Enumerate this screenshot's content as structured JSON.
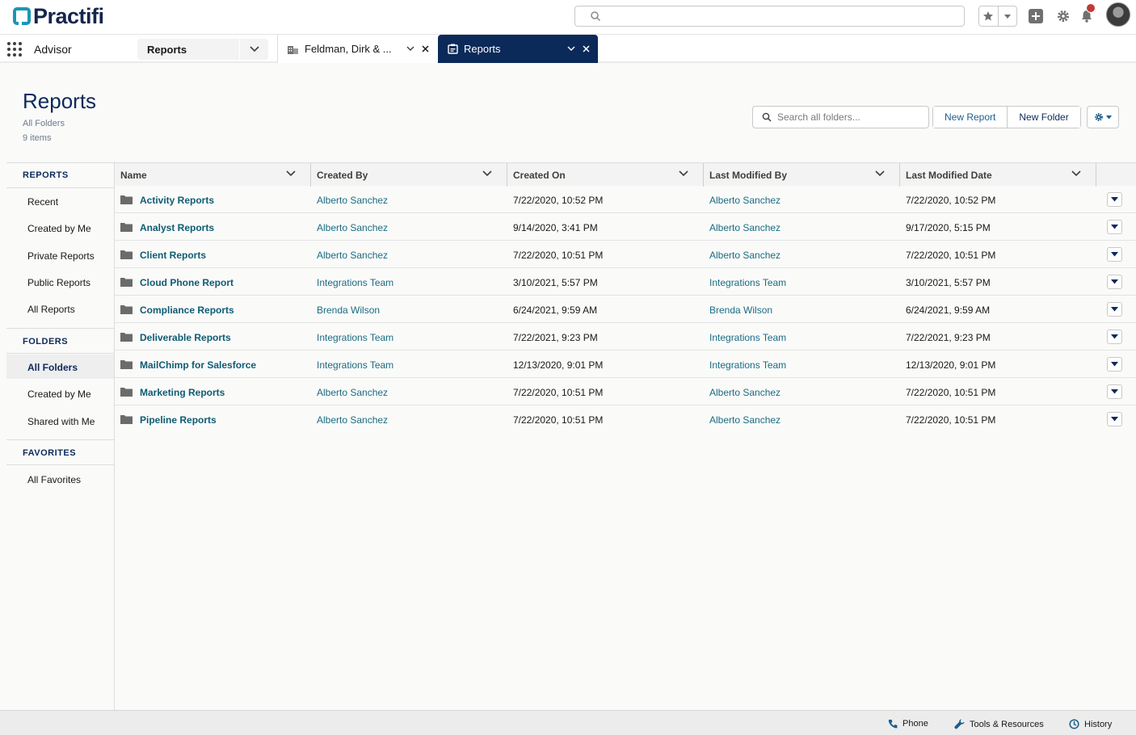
{
  "brand": {
    "name": "Practifi",
    "color": "#14264d",
    "accent": "#1b96b6"
  },
  "header": {
    "search_placeholder": ""
  },
  "nav": {
    "app_name": "Advisor",
    "selector_label": "Reports",
    "tabs": [
      {
        "label": "Feldman, Dirk & ...",
        "icon": "building-icon"
      },
      {
        "label": "Reports",
        "icon": "reports-icon",
        "active": true
      }
    ]
  },
  "page": {
    "title": "Reports",
    "subtitle": "All Folders",
    "count": "9 items",
    "search_placeholder": "Search all folders...",
    "new_report": "New Report",
    "new_folder": "New Folder"
  },
  "sidebar": {
    "reports_title": "REPORTS",
    "reports_items": [
      "Recent",
      "Created by Me",
      "Private Reports",
      "Public Reports",
      "All Reports"
    ],
    "folders_title": "FOLDERS",
    "folders_items": [
      "All Folders",
      "Created by Me",
      "Shared with Me"
    ],
    "favorites_title": "FAVORITES",
    "favorites_items": [
      "All Favorites"
    ]
  },
  "table": {
    "columns": [
      "Name",
      "Created By",
      "Created On",
      "Last Modified By",
      "Last Modified Date"
    ],
    "rows": [
      [
        "Activity Reports",
        "Alberto Sanchez",
        "7/22/2020, 10:52 PM",
        "Alberto Sanchez",
        "7/22/2020, 10:52 PM"
      ],
      [
        "Analyst Reports",
        "Alberto Sanchez",
        "9/14/2020, 3:41 PM",
        "Alberto Sanchez",
        "9/17/2020, 5:15 PM"
      ],
      [
        "Client Reports",
        "Alberto Sanchez",
        "7/22/2020, 10:51 PM",
        "Alberto Sanchez",
        "7/22/2020, 10:51 PM"
      ],
      [
        "Cloud Phone Report",
        "Integrations Team",
        "3/10/2021, 5:57 PM",
        "Integrations Team",
        "3/10/2021, 5:57 PM"
      ],
      [
        "Compliance Reports",
        "Brenda Wilson",
        "6/24/2021, 9:59 AM",
        "Brenda Wilson",
        "6/24/2021, 9:59 AM"
      ],
      [
        "Deliverable Reports",
        "Integrations Team",
        "7/22/2021, 9:23 PM",
        "Integrations Team",
        "7/22/2021, 9:23 PM"
      ],
      [
        "MailChimp for Salesforce",
        "Integrations Team",
        "12/13/2020, 9:01 PM",
        "Integrations Team",
        "12/13/2020, 9:01 PM"
      ],
      [
        "Marketing Reports",
        "Alberto Sanchez",
        "7/22/2020, 10:51 PM",
        "Alberto Sanchez",
        "7/22/2020, 10:51 PM"
      ],
      [
        "Pipeline Reports",
        "Alberto Sanchez",
        "7/22/2020, 10:51 PM",
        "Alberto Sanchez",
        "7/22/2020, 10:51 PM"
      ]
    ]
  },
  "utility": {
    "phone": "Phone",
    "tools": "Tools & Resources",
    "history": "History"
  }
}
